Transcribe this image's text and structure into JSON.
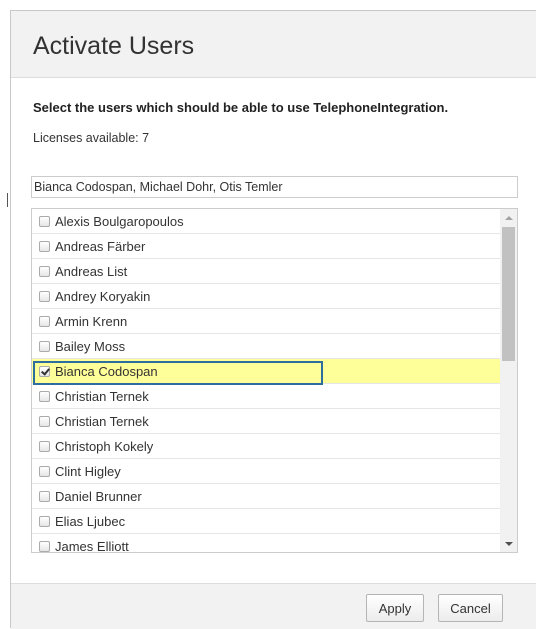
{
  "dialog": {
    "title": "Activate Users",
    "instruction": "Select the users which should be able to use TelephoneIntegration.",
    "licenses": "Licenses available: 7",
    "selected_value": "Bianca Codospan, Michael Dohr, Otis Temler"
  },
  "users": [
    {
      "name": "Alexis Boulgaropoulos",
      "checked": false
    },
    {
      "name": "Andreas Färber",
      "checked": false
    },
    {
      "name": "Andreas List",
      "checked": false
    },
    {
      "name": "Andrey Koryakin",
      "checked": false
    },
    {
      "name": "Armin Krenn",
      "checked": false
    },
    {
      "name": "Bailey Moss",
      "checked": false
    },
    {
      "name": "Bianca Codospan",
      "checked": true
    },
    {
      "name": "Christian Ternek",
      "checked": false
    },
    {
      "name": "Christian Ternek",
      "checked": false
    },
    {
      "name": "Christoph Kokely",
      "checked": false
    },
    {
      "name": "Clint Higley",
      "checked": false
    },
    {
      "name": "Daniel Brunner",
      "checked": false
    },
    {
      "name": "Elias Ljubec",
      "checked": false
    },
    {
      "name": "James Elliott",
      "checked": false
    }
  ],
  "footer": {
    "apply_label": "Apply",
    "cancel_label": "Cancel"
  },
  "colors": {
    "header_bg": "#f2f2f2",
    "checked_row_bg": "#ffff99",
    "focus_border": "#2e6e9e"
  }
}
